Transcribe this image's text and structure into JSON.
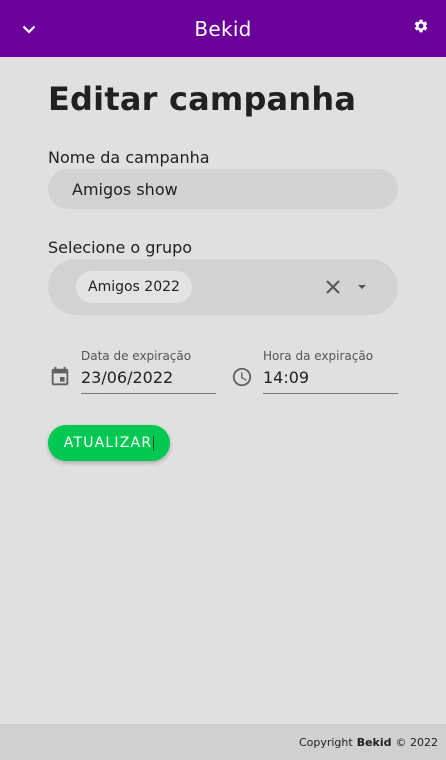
{
  "appbar": {
    "title": "Bekid",
    "menu_icon": "chevron-down-icon",
    "settings_icon": "gear-icon",
    "color": "#6a0099"
  },
  "page": {
    "title": "Editar campanha"
  },
  "form": {
    "campaign_name_label": "Nome da campanha",
    "campaign_name_value": "Amigos show",
    "group_label": "Selecione o grupo",
    "group_chip": "Amigos 2022",
    "expiry_date_label": "Data de expiração",
    "expiry_date_value": "23/06/2022",
    "expiry_time_label": "Hora da expiração",
    "expiry_time_value": "14:09",
    "submit_label": "ATUALIZAR",
    "submit_color": "#00c853"
  },
  "footer": {
    "prefix": "Copyright",
    "brand": "Bekid",
    "suffix": "© 2022"
  }
}
